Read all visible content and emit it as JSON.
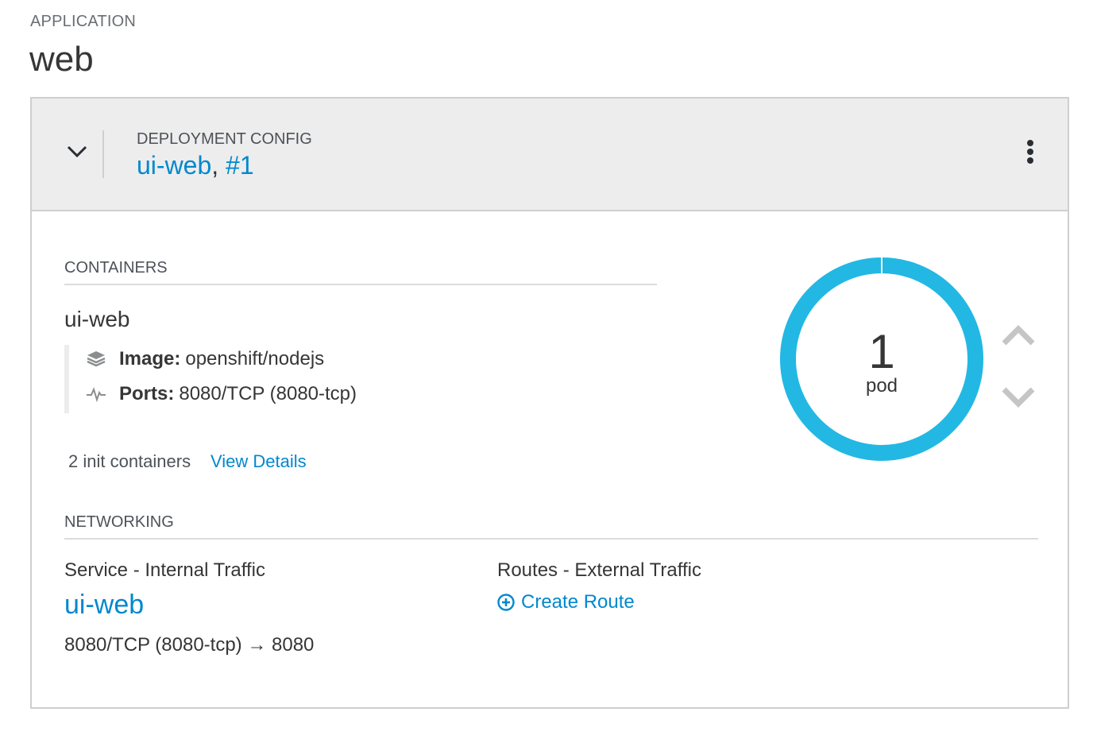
{
  "application": {
    "label": "APPLICATION",
    "name": "web"
  },
  "deployment": {
    "label": "DEPLOYMENT CONFIG",
    "name": "ui-web",
    "separator": ",",
    "version": "#1"
  },
  "containers": {
    "section_label": "CONTAINERS",
    "name": "ui-web",
    "image_label": "Image:",
    "image_value": "openshift/nodejs",
    "ports_label": "Ports:",
    "ports_value": "8080/TCP (8080-tcp)",
    "init_text": "2 init containers",
    "view_details": "View Details"
  },
  "pods": {
    "count": "1",
    "label": "pod",
    "color": "#22b8e3"
  },
  "networking": {
    "section_label": "NETWORKING",
    "service_heading": "Service - Internal Traffic",
    "service_name": "ui-web",
    "service_ports": "8080/TCP (8080-tcp) → 8080",
    "routes_heading": "Routes - External Traffic",
    "create_route": "Create Route"
  },
  "colors": {
    "link": "#0088ce",
    "header_bg": "#ededed",
    "border": "#cfcfcf"
  },
  "icons": {
    "toggle": "chevron-down-icon",
    "kebab": "kebab-menu-icon",
    "image": "layers-icon",
    "ports": "pulse-icon",
    "scale_up": "chevron-up-icon",
    "scale_down": "chevron-down-icon",
    "create_route": "plus-circle-icon"
  }
}
